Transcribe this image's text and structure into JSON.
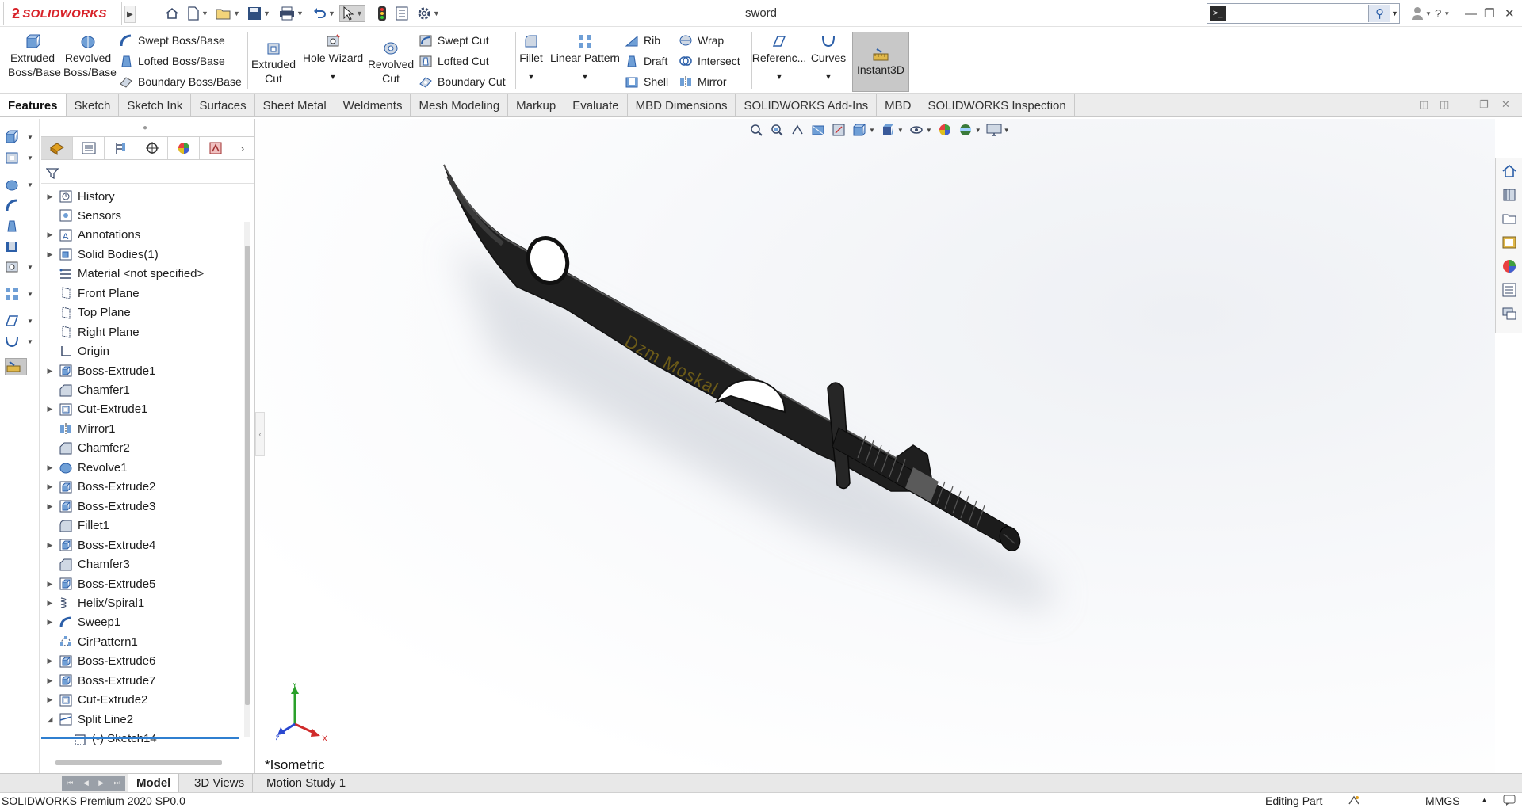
{
  "app": {
    "logo_text": "SOLIDWORKS",
    "document_title": "sword"
  },
  "search": {
    "placeholder": "",
    "value": ""
  },
  "ribbon": {
    "extruded_boss": "Extruded Boss/Base",
    "revolved_boss": "Revolved Boss/Base",
    "swept_boss": "Swept Boss/Base",
    "lofted_boss": "Lofted Boss/Base",
    "boundary_boss": "Boundary Boss/Base",
    "extruded_cut": "Extruded Cut",
    "hole_wizard": "Hole Wizard",
    "revolved_cut": "Revolved Cut",
    "swept_cut": "Swept Cut",
    "lofted_cut": "Lofted Cut",
    "boundary_cut": "Boundary Cut",
    "fillet": "Fillet",
    "linear_pattern": "Linear Pattern",
    "rib": "Rib",
    "draft": "Draft",
    "shell": "Shell",
    "wrap": "Wrap",
    "intersect": "Intersect",
    "mirror": "Mirror",
    "reference": "Referenc...",
    "curves": "Curves",
    "instant3d": "Instant3D"
  },
  "tabs": [
    "Features",
    "Sketch",
    "Sketch Ink",
    "Surfaces",
    "Sheet Metal",
    "Weldments",
    "Mesh Modeling",
    "Markup",
    "Evaluate",
    "MBD Dimensions",
    "SOLIDWORKS Add-Ins",
    "MBD",
    "SOLIDWORKS Inspection"
  ],
  "tree": [
    {
      "label": "History",
      "expandable": true,
      "icon": "history-icon"
    },
    {
      "label": "Sensors",
      "expandable": false,
      "icon": "sensor-icon"
    },
    {
      "label": "Annotations",
      "expandable": true,
      "icon": "annotation-icon"
    },
    {
      "label": "Solid Bodies(1)",
      "expandable": true,
      "icon": "solid-bodies-icon"
    },
    {
      "label": "Material <not specified>",
      "expandable": false,
      "icon": "material-icon"
    },
    {
      "label": "Front Plane",
      "expandable": false,
      "icon": "plane-icon"
    },
    {
      "label": "Top Plane",
      "expandable": false,
      "icon": "plane-icon"
    },
    {
      "label": "Right Plane",
      "expandable": false,
      "icon": "plane-icon"
    },
    {
      "label": "Origin",
      "expandable": false,
      "icon": "origin-icon"
    },
    {
      "label": "Boss-Extrude1",
      "expandable": true,
      "icon": "extrude-icon"
    },
    {
      "label": "Chamfer1",
      "expandable": false,
      "icon": "chamfer-icon"
    },
    {
      "label": "Cut-Extrude1",
      "expandable": true,
      "icon": "cut-extrude-icon"
    },
    {
      "label": "Mirror1",
      "expandable": false,
      "icon": "mirror-icon"
    },
    {
      "label": "Chamfer2",
      "expandable": false,
      "icon": "chamfer-icon"
    },
    {
      "label": "Revolve1",
      "expandable": true,
      "icon": "revolve-icon"
    },
    {
      "label": "Boss-Extrude2",
      "expandable": true,
      "icon": "extrude-icon"
    },
    {
      "label": "Boss-Extrude3",
      "expandable": true,
      "icon": "extrude-icon"
    },
    {
      "label": "Fillet1",
      "expandable": false,
      "icon": "fillet-icon"
    },
    {
      "label": "Boss-Extrude4",
      "expandable": true,
      "icon": "extrude-icon"
    },
    {
      "label": "Chamfer3",
      "expandable": false,
      "icon": "chamfer-icon"
    },
    {
      "label": "Boss-Extrude5",
      "expandable": true,
      "icon": "extrude-icon"
    },
    {
      "label": "Helix/Spiral1",
      "expandable": true,
      "icon": "helix-icon"
    },
    {
      "label": "Sweep1",
      "expandable": true,
      "icon": "sweep-icon"
    },
    {
      "label": "CirPattern1",
      "expandable": false,
      "icon": "circular-pattern-icon"
    },
    {
      "label": "Boss-Extrude6",
      "expandable": true,
      "icon": "extrude-icon"
    },
    {
      "label": "Boss-Extrude7",
      "expandable": true,
      "icon": "extrude-icon"
    },
    {
      "label": "Cut-Extrude2",
      "expandable": true,
      "icon": "cut-extrude-icon"
    },
    {
      "label": "Split Line2",
      "expandable": true,
      "expanded": true,
      "icon": "split-line-icon"
    },
    {
      "label": "(-) Sketch14",
      "expandable": false,
      "child": true,
      "icon": "sketch-icon"
    }
  ],
  "viewport": {
    "view_name": "*Isometric",
    "engraving_text": "Dzm Moskal",
    "triad": {
      "x": "X",
      "y": "Y",
      "z": "Z"
    }
  },
  "bottom_tabs": [
    "Model",
    "3D Views",
    "Motion Study 1"
  ],
  "status": {
    "product": "SOLIDWORKS Premium 2020 SP0.0",
    "mode": "Editing Part",
    "units": "MMGS"
  },
  "colors": {
    "brand": "#d8232a",
    "accent": "#2f7fd0",
    "sword": "#222222"
  }
}
